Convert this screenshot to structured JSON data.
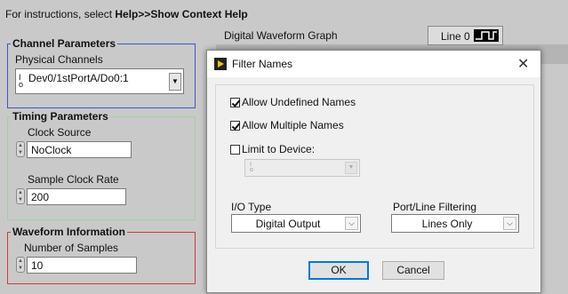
{
  "instructions": {
    "prefix": "For instructions, select ",
    "bold": "Help>>Show Context Help"
  },
  "channel_parameters": {
    "title": "Channel Parameters",
    "physical_channels_label": "Physical Channels",
    "physical_channels_value": "Dev0/1stPortA/Do0:1"
  },
  "timing_parameters": {
    "title": "Timing Parameters",
    "clock_source_label": "Clock Source",
    "clock_source_value": "NoClock",
    "sample_clock_rate_label": "Sample Clock Rate",
    "sample_clock_rate_value": "200"
  },
  "waveform_information": {
    "title": "Waveform Information",
    "number_of_samples_label": "Number of Samples",
    "number_of_samples_value": "10"
  },
  "graph": {
    "title": "Digital Waveform Graph",
    "line_label": "Line 0"
  },
  "dialog": {
    "title": "Filter Names",
    "close_glyph": "✕",
    "allow_undefined": {
      "label": "Allow Undefined Names",
      "checked": true
    },
    "allow_multiple": {
      "label": "Allow Multiple Names",
      "checked": true
    },
    "limit_to_device": {
      "label": "Limit to Device:",
      "checked": false
    },
    "io_type_label": "I/O Type",
    "io_type_value": "Digital Output",
    "port_line_label": "Port/Line Filtering",
    "port_line_value": "Lines Only",
    "ok_label": "OK",
    "cancel_label": "Cancel"
  },
  "icons": {
    "io_glyph_top": "I",
    "io_glyph_bottom": "o",
    "dropdown": "▼",
    "combo_arrow": "⌵"
  }
}
